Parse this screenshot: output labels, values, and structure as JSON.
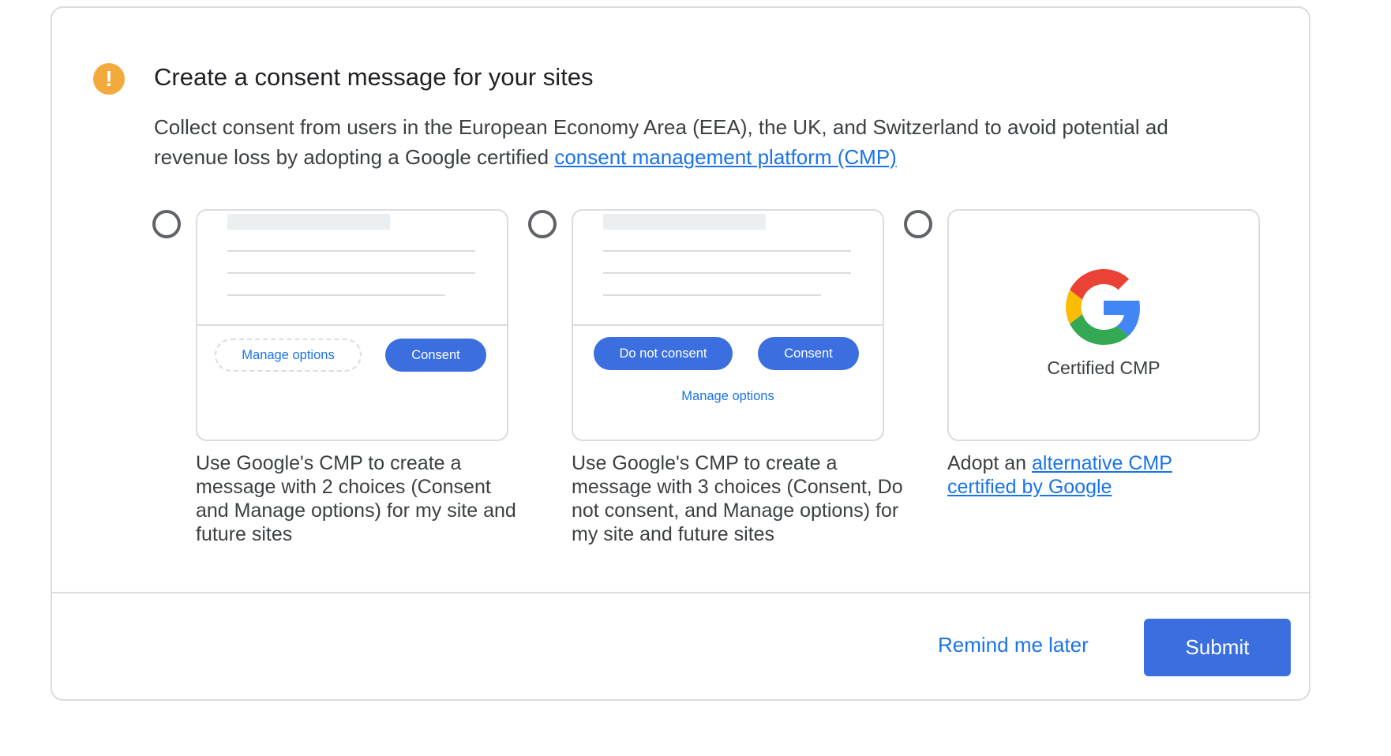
{
  "header": {
    "icon": "warning-icon",
    "title": "Create a consent message for your sites",
    "description_prefix": "Collect consent from users in the European Economy Area (EEA), the UK, and Switzerland to avoid potential ad revenue loss by adopting a Google certified ",
    "description_link": "consent management platform (CMP)"
  },
  "options": [
    {
      "preview": {
        "manage": "Manage options",
        "consent": "Consent"
      },
      "caption": "Use Google's CMP to create a message with 2 choices (Consent and Manage options) for my site and future sites"
    },
    {
      "preview": {
        "do_not_consent": "Do not consent",
        "consent": "Consent",
        "manage": "Manage options"
      },
      "caption": "Use Google's CMP to create a message with 3 choices (Consent, Do not consent, and Manage options) for my site and future sites"
    },
    {
      "preview": {
        "logo": "google-g-logo",
        "label": "Certified CMP"
      },
      "caption_prefix": "Adopt an ",
      "caption_link": "alternative CMP certified by Google"
    }
  ],
  "footer": {
    "remind_label": "Remind me later",
    "submit_label": "Submit"
  },
  "colors": {
    "accent": "#1a73e8",
    "button": "#3b6fe0",
    "warning": "#f2aa3d",
    "border": "#dadce0"
  }
}
